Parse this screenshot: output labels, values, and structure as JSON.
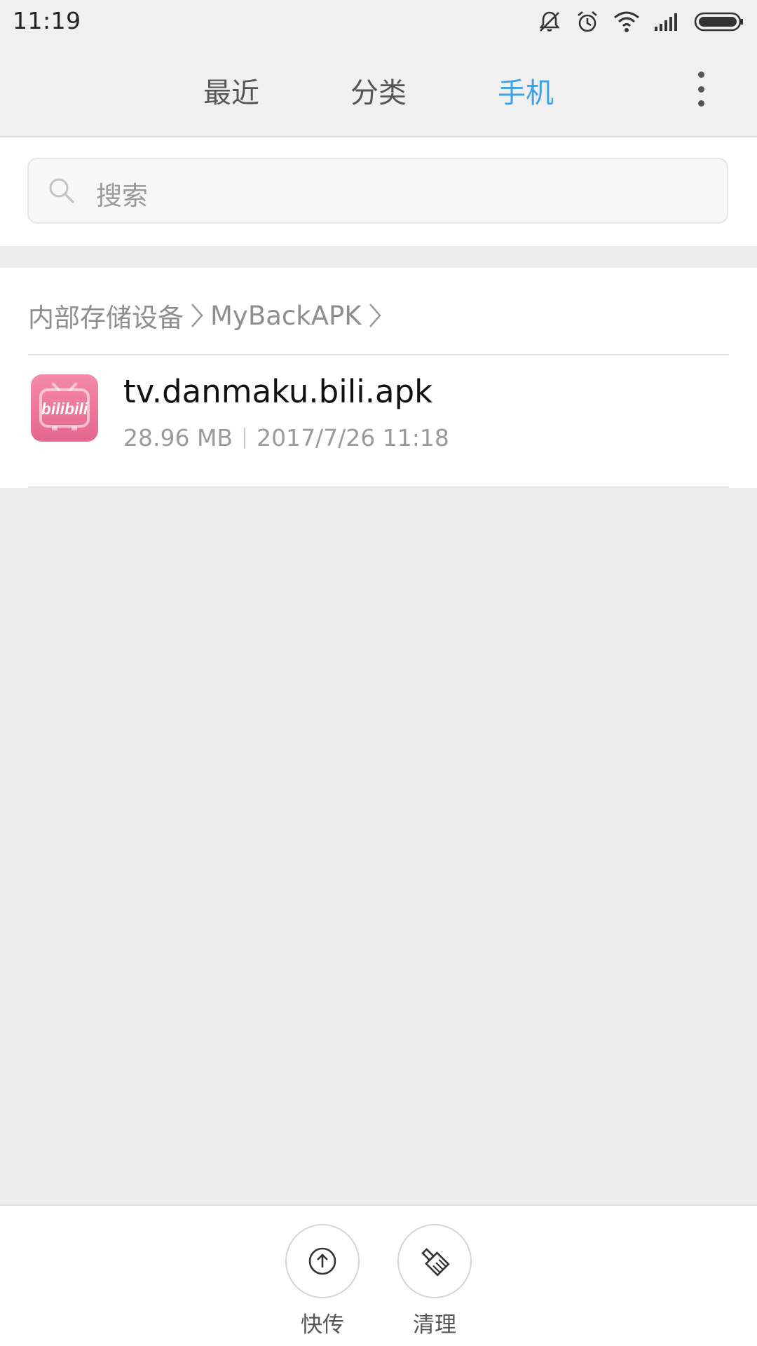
{
  "status_bar": {
    "time": "11:19",
    "icons": [
      "mute-notification-icon",
      "alarm-icon",
      "wifi-icon",
      "signal-icon",
      "battery-icon"
    ]
  },
  "tabs": [
    {
      "label": "最近",
      "active": false
    },
    {
      "label": "分类",
      "active": false
    },
    {
      "label": "手机",
      "active": true
    }
  ],
  "header": {
    "more_icon": "more-vertical-icon"
  },
  "search": {
    "placeholder": "搜索"
  },
  "breadcrumb": [
    "内部存储设备",
    "MyBackAPK"
  ],
  "files": [
    {
      "name": "tv.danmaku.bili.apk",
      "size": "28.96 MB",
      "date": "2017/7/26 11:18",
      "icon": "bilibili-app-icon",
      "icon_text": "bilibili"
    }
  ],
  "actions": [
    {
      "label": "快传",
      "icon": "upload-icon"
    },
    {
      "label": "清理",
      "icon": "broom-icon"
    }
  ],
  "colors": {
    "accent": "#3ea3ea",
    "background": "#eeeeee",
    "bilibili_pink": "#f48aa8"
  }
}
